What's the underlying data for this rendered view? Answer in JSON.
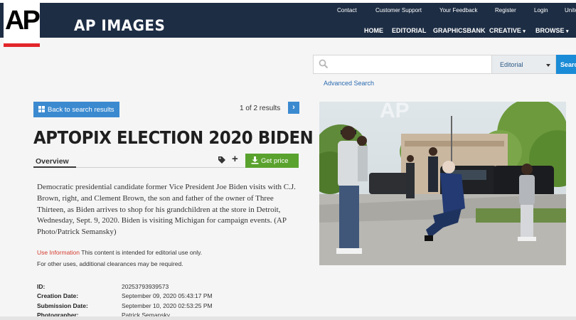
{
  "header": {
    "logo_text": "AP",
    "brand": "AP IMAGES",
    "utility_links": [
      "Contact",
      "Customer Support",
      "Your Feedback",
      "Register",
      "Login",
      "Unite"
    ],
    "nav": [
      "HOME",
      "EDITORIAL",
      "GRAPHICSBANK",
      "CREATIVE",
      "BROWSE"
    ],
    "nav_dropdown_caret": "▾",
    "colors": {
      "header_bg": "#1d2d44",
      "logo_red": "#e2262a"
    }
  },
  "search": {
    "placeholder": "",
    "select_value": "Editorial",
    "button_label": "Search",
    "advanced_label": "Advanced Search"
  },
  "detail": {
    "back_label": "Back to search results",
    "results_text": "1 of 2 results",
    "next_symbol": "›",
    "title": "APTOPIX ELECTION 2020 BIDEN",
    "tab_overview": "Overview",
    "plus_symbol": "+",
    "price_label": "Get price",
    "caption": "Democratic presidential candidate former Vice President Joe Biden visits with C.J. Brown, right, and Clement Brown, the son and father of the owner of Three Thirteen, as Biden arrives to shop for his grandchildren at the store in Detroit, Wednesday, Sept. 9, 2020. Biden is visiting Michigan for campaign events. (AP Photo/Patrick Semansky)",
    "use_info_link": "Use Information",
    "use_info_text": " This content is intended for editorial use only.",
    "other_uses": "For other uses, additional clearances may be required.",
    "meta": [
      {
        "label": "ID:",
        "value": "20253793939573"
      },
      {
        "label": "Creation Date:",
        "value": "September 09, 2020 05:43:17 PM"
      },
      {
        "label": "Submission Date:",
        "value": "September 10, 2020 02:53:25 PM"
      },
      {
        "label": "Photographer:",
        "value": "Patrick Semansky"
      }
    ]
  },
  "photo": {
    "watermark": "AP"
  },
  "icons": [
    "search-icon",
    "grid-icon",
    "chevron-right-icon",
    "tag-icon",
    "plus-icon",
    "download-icon",
    "caret-down-icon"
  ]
}
